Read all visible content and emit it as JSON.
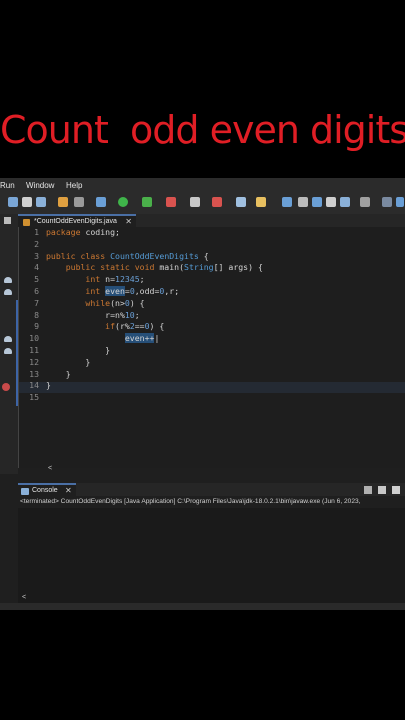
{
  "overlay_title": "Count  odd even digits",
  "menu": [
    "Run",
    "Window",
    "Help"
  ],
  "editor_tab": {
    "label": "*CountOddEvenDigits.java",
    "close": "✕"
  },
  "code_lines": [
    {
      "n": "1",
      "parts": [
        {
          "t": "package",
          "c": "kw"
        },
        {
          "t": " coding;",
          "c": ""
        }
      ]
    },
    {
      "n": "2",
      "parts": []
    },
    {
      "n": "3",
      "parts": [
        {
          "t": "public class ",
          "c": "kw"
        },
        {
          "t": "CountOddEvenDigits",
          "c": "ty"
        },
        {
          "t": " {",
          "c": ""
        }
      ]
    },
    {
      "n": "4",
      "parts": [
        {
          "t": "    public static void ",
          "c": "kw"
        },
        {
          "t": "main(",
          "c": ""
        },
        {
          "t": "String",
          "c": "ty"
        },
        {
          "t": "[] args) {",
          "c": ""
        }
      ]
    },
    {
      "n": "5",
      "parts": [
        {
          "t": "        int ",
          "c": "kw"
        },
        {
          "t": "n=",
          "c": ""
        },
        {
          "t": "12345",
          "c": "num"
        },
        {
          "t": ";",
          "c": ""
        }
      ]
    },
    {
      "n": "6",
      "parts": [
        {
          "t": "        int ",
          "c": "kw"
        },
        {
          "t": "even",
          "c": "hl"
        },
        {
          "t": "=",
          "c": ""
        },
        {
          "t": "0",
          "c": "num"
        },
        {
          "t": ",odd=",
          "c": ""
        },
        {
          "t": "0",
          "c": "num"
        },
        {
          "t": ",r;",
          "c": ""
        }
      ]
    },
    {
      "n": "7",
      "parts": [
        {
          "t": "        while",
          "c": "kw"
        },
        {
          "t": "(n>",
          "c": ""
        },
        {
          "t": "0",
          "c": "num"
        },
        {
          "t": ") {",
          "c": ""
        }
      ]
    },
    {
      "n": "8",
      "parts": [
        {
          "t": "            r=n%",
          "c": ""
        },
        {
          "t": "10",
          "c": "num"
        },
        {
          "t": ";",
          "c": ""
        }
      ]
    },
    {
      "n": "9",
      "parts": [
        {
          "t": "            if",
          "c": "kw"
        },
        {
          "t": "(r%",
          "c": ""
        },
        {
          "t": "2",
          "c": "num"
        },
        {
          "t": "==",
          "c": ""
        },
        {
          "t": "0",
          "c": "num"
        },
        {
          "t": ") {",
          "c": ""
        }
      ]
    },
    {
      "n": "10",
      "parts": [
        {
          "t": "                ",
          "c": ""
        },
        {
          "t": "even++",
          "c": "hl"
        },
        {
          "t": "|",
          "c": ""
        }
      ]
    },
    {
      "n": "11",
      "parts": [
        {
          "t": "            }",
          "c": ""
        }
      ]
    },
    {
      "n": "12",
      "parts": [
        {
          "t": "        }",
          "c": ""
        }
      ]
    },
    {
      "n": "13",
      "parts": [
        {
          "t": "    }",
          "c": ""
        }
      ]
    },
    {
      "n": "14",
      "parts": [
        {
          "t": "}",
          "c": ""
        }
      ]
    },
    {
      "n": "15",
      "parts": []
    }
  ],
  "console_tab": {
    "label": "Console",
    "close": "✕"
  },
  "terminated_text": "<terminated> CountOddEvenDigits [Java Application] C:\\Program Files\\Java\\jdk-18.0.2.1\\bin\\javaw.exe  (Jun 6, 2023,",
  "scroll_left": "<"
}
